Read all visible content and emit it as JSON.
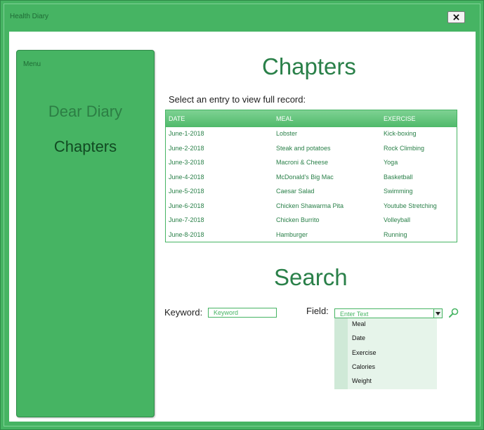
{
  "window": {
    "title": "Health Diary"
  },
  "menu": {
    "label": "Menu",
    "items": [
      {
        "label": "Dear Diary"
      },
      {
        "label": "Chapters"
      }
    ]
  },
  "chapters": {
    "title": "Chapters",
    "subtitle": "Select an entry to view full record:",
    "columns": [
      "DATE",
      "MEAL",
      "EXERCISE"
    ],
    "rows": [
      {
        "date": "June-1-2018",
        "meal": "Lobster",
        "exercise": "Kick-boxing"
      },
      {
        "date": "June-2-2018",
        "meal": "Steak and potatoes",
        "exercise": "Rock Climbing"
      },
      {
        "date": "June-3-2018",
        "meal": "Macroni & Cheese",
        "exercise": "Yoga"
      },
      {
        "date": "June-4-2018",
        "meal": "McDonald's Big Mac",
        "exercise": "Basketball"
      },
      {
        "date": "June-5-2018",
        "meal": "Caesar Salad",
        "exercise": "Swimming"
      },
      {
        "date": "June-6-2018",
        "meal": "Chicken Shawarma Pita",
        "exercise": "Youtube Stretching"
      },
      {
        "date": "June-7-2018",
        "meal": "Chicken Burrito",
        "exercise": "Volleyball"
      },
      {
        "date": "June-8-2018",
        "meal": "Hamburger",
        "exercise": "Running"
      }
    ]
  },
  "search": {
    "title": "Search",
    "keyword_label": "Keyword:",
    "keyword_placeholder": "Keyword",
    "field_label": "Field:",
    "field_placeholder": "Enter Text",
    "field_options": [
      "Meal",
      "Date",
      "Exercise",
      "Calories",
      "Weight"
    ]
  },
  "icons": {
    "close": "close-icon",
    "dropdown": "chevron-down-icon",
    "search": "search-icon"
  },
  "colors": {
    "accent": "#46b463",
    "title_text": "#2a8049",
    "table_header": "#6ccb84",
    "dropdown_bg": "#e6f4ea"
  }
}
